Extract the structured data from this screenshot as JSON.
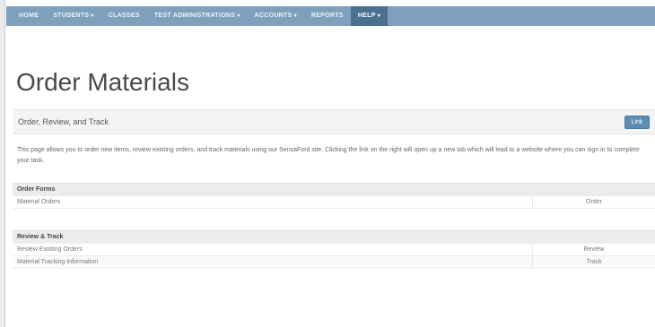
{
  "nav": {
    "items": [
      {
        "label": "HOME",
        "dropdown": false,
        "active": false
      },
      {
        "label": "STUDENTS",
        "dropdown": true,
        "active": false
      },
      {
        "label": "CLASSES",
        "dropdown": false,
        "active": false
      },
      {
        "label": "TEST ADMINISTRATIONS",
        "dropdown": true,
        "active": false
      },
      {
        "label": "ACCOUNTS",
        "dropdown": true,
        "active": false
      },
      {
        "label": "REPORTS",
        "dropdown": false,
        "active": false
      },
      {
        "label": "HELP",
        "dropdown": true,
        "active": true
      }
    ],
    "caret_glyph": "▾",
    "bar_color": "#7ea0bd",
    "active_color": "#49708f"
  },
  "page": {
    "title": "Order Materials"
  },
  "panel": {
    "header": "Order, Review, and Track",
    "link_button": "Link",
    "description": "This page allows you to order new items, review existing orders, and track materials using our SensaFord site. Clicking the link on the right will open up a new tab which will lead to a website where you can sign in to complete your task.",
    "button_color": "#5b8db5"
  },
  "sections": [
    {
      "heading": "Order Forms",
      "rows": [
        {
          "name": "Material Orders",
          "action": "Order"
        }
      ]
    },
    {
      "heading": "Review & Track",
      "rows": [
        {
          "name": "Review Existing Orders",
          "action": "Review"
        },
        {
          "name": "Material Tracking Information",
          "action": "Track"
        }
      ]
    }
  ]
}
